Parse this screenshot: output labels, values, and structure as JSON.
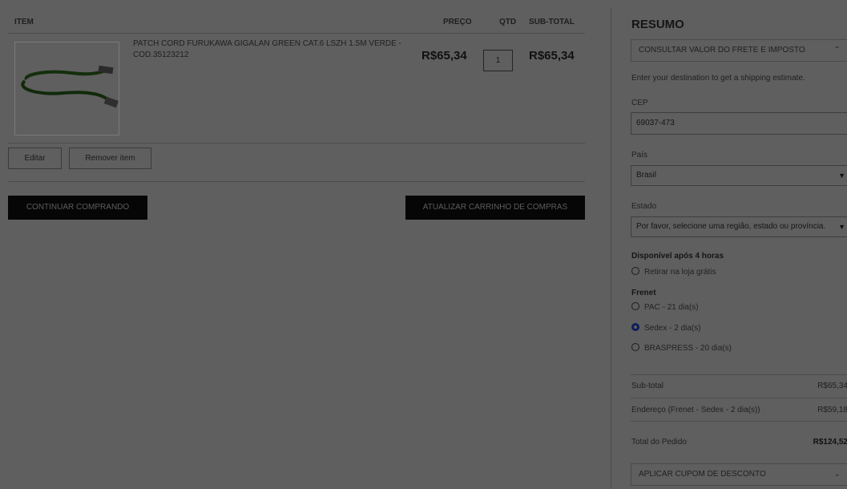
{
  "cart": {
    "headers": {
      "item": "ITEM",
      "price": "PREÇO",
      "qty": "QTD",
      "subtotal": "SUB-TOTAL"
    },
    "item": {
      "name": "PATCH CORD FURUKAWA GIGALAN GREEN CAT.6 LSZH 1.5M VERDE - COD.35123212",
      "price": "R$65,34",
      "qty": "1",
      "subtotal": "R$65,34",
      "image_icon": "patch-cord-cable-image"
    },
    "edit_label": "Editar",
    "remove_label": "Remover item",
    "continue_label": "CONTINUAR COMPRANDO",
    "update_label": "ATUALIZAR CARRINHO DE COMPRAS"
  },
  "summary": {
    "title": "RESUMO",
    "shipping_toggle": "CONSULTAR VALOR DO FRETE E IMPOSTO",
    "shipping_hint": "Enter your destination to get a shipping estimate.",
    "cep_label": "CEP",
    "cep_value": "69037-473",
    "country_label": "País",
    "country_value": "Brasil",
    "state_label": "Estado",
    "state_value": "Por favor, selecione uma região, estado ou província.",
    "pickup_group": "Disponível após 4 horas",
    "pickup_option": "Retirar na loja grátis",
    "frenet_group": "Frenet",
    "frenet_options": [
      "PAC - 21 dia(s)",
      "Sedex - 2 dia(s)",
      "BRASPRESS - 20 dia(s)"
    ],
    "selected_option": "Sedex - 2 dia(s)",
    "totals": [
      {
        "label": "Sub-total",
        "value": "R$65,34"
      },
      {
        "label": "Endereço (Frenet - Sedex - 2 dia(s))",
        "value": "R$59,18"
      },
      {
        "label": "Total do Pedido",
        "value": "R$124,52"
      }
    ],
    "coupon_toggle": "APLICAR CUPOM DE DESCONTO"
  },
  "colors": {
    "overlay": "#5f5f5f",
    "dark_button": "#060606",
    "radio_selected": "#0f1d5a"
  }
}
